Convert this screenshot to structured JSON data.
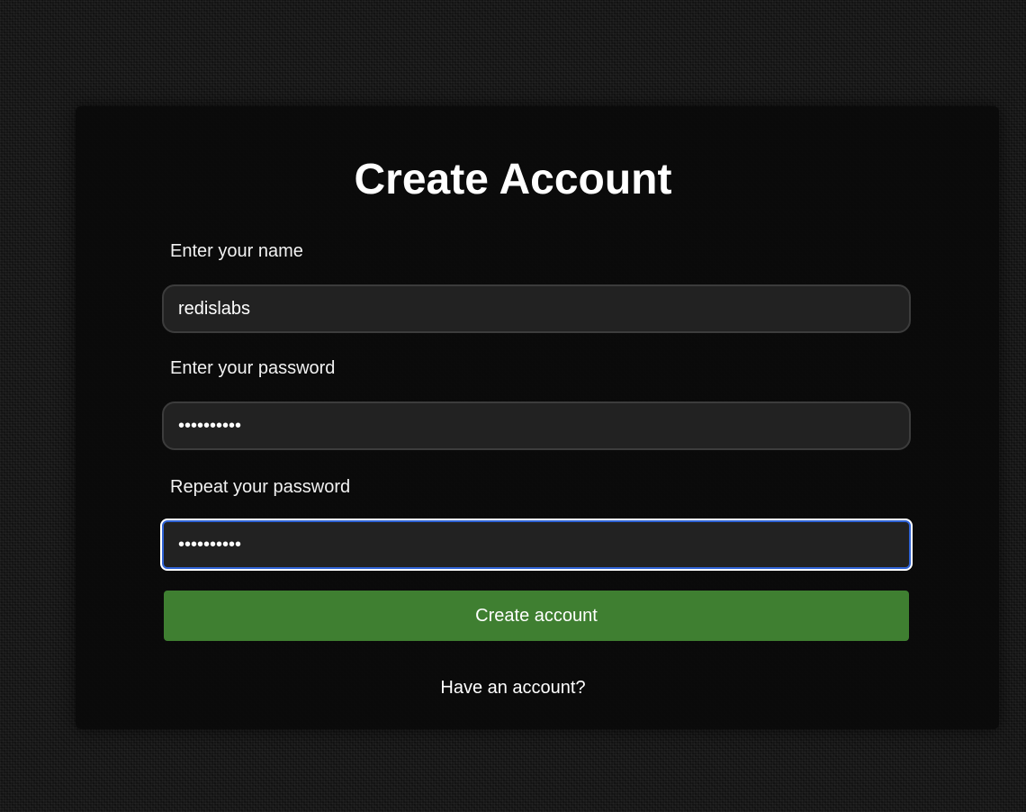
{
  "form": {
    "title": "Create Account",
    "name_label": "Enter your name",
    "name_value": "redislabs",
    "password_label": "Enter your password",
    "password_value": "••••••••••",
    "repeat_label": "Repeat your password",
    "repeat_value": "••••••••••",
    "submit_label": "Create account",
    "login_link": "Have an account?"
  }
}
